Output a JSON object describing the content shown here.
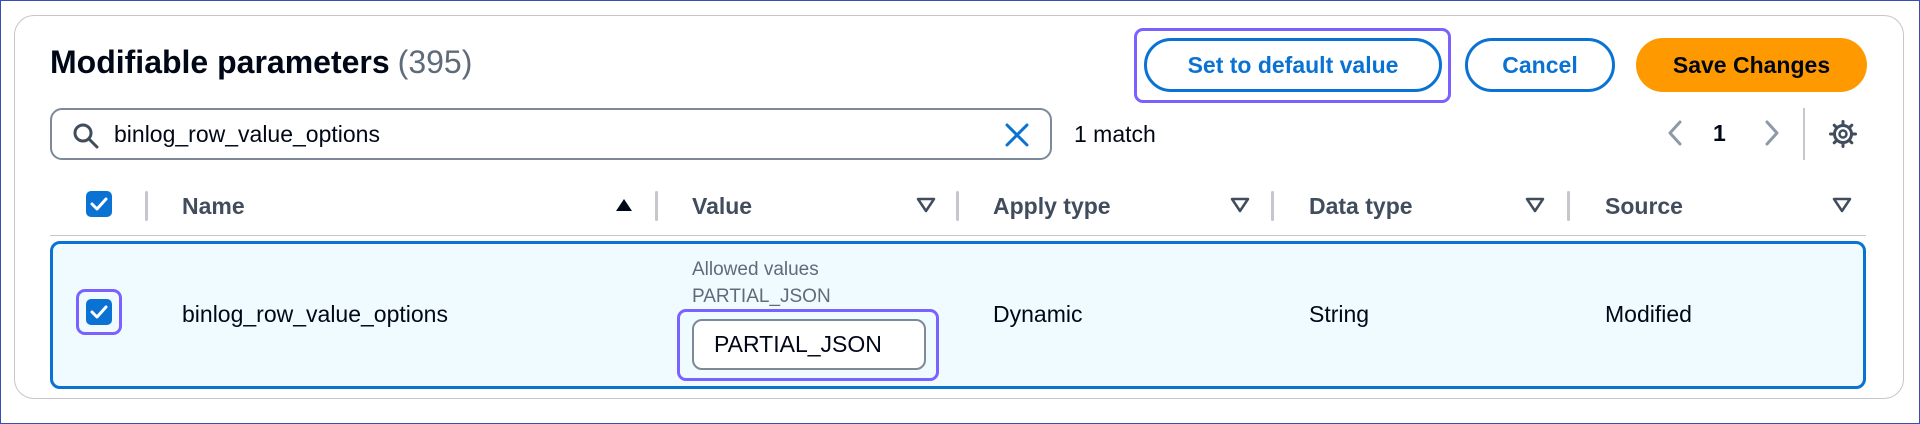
{
  "header": {
    "title": "Modifiable parameters",
    "count": "(395)"
  },
  "actions": {
    "set_default_label": "Set to default value",
    "cancel_label": "Cancel",
    "save_label": "Save Changes"
  },
  "search": {
    "value": "binlog_row_value_options",
    "match_text": "1 match"
  },
  "pagination": {
    "current_page": "1"
  },
  "table": {
    "all_selected": true,
    "columns": [
      {
        "label": "Name",
        "sort": "ascending"
      },
      {
        "label": "Value",
        "sort": "none"
      },
      {
        "label": "Apply type",
        "sort": "none"
      },
      {
        "label": "Data type",
        "sort": "none"
      },
      {
        "label": "Source",
        "sort": "none"
      }
    ],
    "rows": [
      {
        "selected": true,
        "name": "binlog_row_value_options",
        "allowed_label": "Allowed values",
        "allowed_values": "PARTIAL_JSON",
        "value": "PARTIAL_JSON",
        "apply_type": "Dynamic",
        "data_type": "String",
        "source": "Modified"
      }
    ]
  },
  "icons": {
    "search": "search-icon",
    "clear": "close-icon",
    "prev": "chevron-left-icon",
    "next": "chevron-right-icon",
    "settings": "gear-icon",
    "sort_asc": "caret-up-icon",
    "sort_none": "caret-down-outline-icon",
    "check": "check-icon"
  },
  "colors": {
    "accent": "#0972d3",
    "primary_button": "#ff9900",
    "focus": "#7b61ff",
    "selected_row_bg": "#f0fbff"
  }
}
